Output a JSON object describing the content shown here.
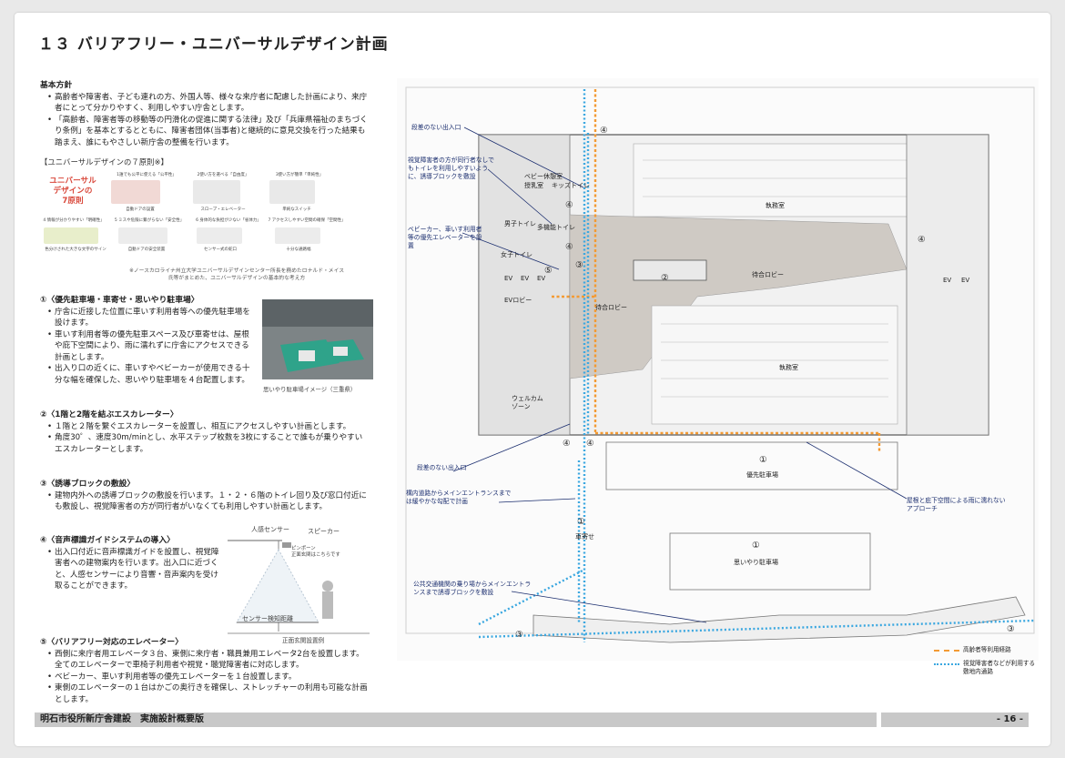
{
  "title": "１３ バリアフリー・ユニバーサルデザイン計画",
  "kihon": {
    "heading": "基本方針",
    "bullets": [
      "高齢者や障害者、子ども連れの方、外国人等、様々な来庁者に配慮した計画により、来庁者にとって分かりやすく、利用しやすい庁舎とします。",
      "「高齢者、障害者等の移動等の円滑化の促進に関する法律」及び「兵庫県福祉のまちづくり条例」を基本とするとともに、障害者団体(当事者)と継続的に意見交換を行った結果も踏まえ、誰にもやさしい新庁舎の整備を行います。"
    ]
  },
  "ud": {
    "heading": "【ユニバーサルデザインの７原則※】",
    "red_label": "ユニバーサル\nデザインの\n7原則",
    "cells": [
      "1誰でも公平に使える「公平性」",
      "2使い方を選べる「自由度」",
      "3使い方が簡単「単純性」",
      "自動ドアの設置",
      "スロープ・エレベーター",
      "単純なスイッチ",
      "4 情報が分かりやすい「明確性」",
      "5 ミスや危険に繋がらない「安全性」",
      "6 身体的な負担が少ない「省体力」",
      "7 アクセスしやすい空間の確保「空間性」",
      "色分けされた大きな文字のサイン",
      "自動ドアの安全装置",
      "センサー式の蛇口",
      "十分な通路幅"
    ],
    "note": "※ノースカロライナ州立大学ユニバーサルデザインセンター所長を務めたロナルド・メイス氏等がまとめた、ユニバーサルデザインの基本的な考え方"
  },
  "sec1": {
    "heading": "①〈優先駐車場・車寄せ・思いやり駐車場〉",
    "bullets": [
      "庁舎に近接した位置に車いす利用者等への優先駐車場を設けます。",
      "車いす利用者等の優先駐車スペース及び車寄せは、屋根や庇下空間により、雨に濡れずに庁舎にアクセスできる計画とします。",
      "出入り口の近くに、車いすやベビーカーが使用できる十分な幅を確保した、思いやり駐車場を４台配置します。"
    ],
    "caption": "思いやり駐車場イメージ（三重県）"
  },
  "sec2": {
    "heading": "②〈1階と2階を結ぶエスカレーター〉",
    "bullets": [
      "１階と２階を繋ぐエスカレーターを設置し、相互にアクセスしやすい計画とします。",
      "角度30゜、速度30m/minとし、水平ステップ枚数を3枚にすることで誰もが乗りやすいエスカレーターとします。"
    ]
  },
  "sec3": {
    "heading": "③〈誘導ブロックの敷設〉",
    "bullets": [
      "建物内外への誘導ブロックの敷設を行います。１・２・６階のトイレ回り及び窓口付近にも敷設し、視覚障害者の方が同行者がいなくても利用しやすい計画とします。"
    ]
  },
  "sec4": {
    "heading": "④〈音声標識ガイドシステムの導入〉",
    "bullets": [
      "出入口付近に音声標識ガイドを設置し、視覚障害者への建物案内を行います。出入口に近づくと、人感センサーにより音響・音声案内を受け取ることができます。"
    ],
    "fig": {
      "sensor": "人感センサー",
      "speaker": "スピーカー",
      "chime": "ピンポーン\n正面玄関はこちらです",
      "range": "センサー検知距離",
      "caption": "正面玄関設置例"
    }
  },
  "sec5": {
    "heading": "⑤〈バリアフリー対応のエレベーター〉",
    "bullets": [
      "西側に来庁者用エレベータ３台、東側に来庁者・職員兼用エレベータ2台を設置します。全てのエレベーターで車椅子利用者や視覚・聴覚障害者に対応します。",
      "ベビーカー、車いす利用者等の優先エレベーターを１台設置します。",
      "東側のエレベーターの１台はかごの奥行きを確保し、ストレッチャーの利用も可能な計画とします。"
    ]
  },
  "plan": {
    "callouts": [
      "段差のない出入口",
      "視覚障害者の方が同行者なしでもトイレを利用しやすいように、誘導ブロックを敷設",
      "ベビーカー、車いす利用者等の優先エレベーターを設置",
      "段差のない出入口",
      "構内道路からメインエントランスまでは緩やかな勾配で計画",
      "公共交通機関の乗り場からメインエントランスまで誘導ブロックを敷設",
      "屋根と庇下空間による雨に濡れないアプローチ"
    ],
    "rooms": [
      "ベビー休憩室",
      "授乳室",
      "キッズトイレ",
      "男子トイレ",
      "女子トイレ",
      "多機能トイレ",
      "EV",
      "EV",
      "EV",
      "EVロビー",
      "待合ロビー",
      "待合ロビー",
      "執務室",
      "執務室",
      "ウェルカムゾーン",
      "優先駐車場",
      "思いやり駐車場",
      "車寄せ",
      "EV",
      "EV"
    ],
    "numbers": [
      "④",
      "④",
      "④",
      "④",
      "④",
      "④",
      "③",
      "③",
      "③",
      "⑤",
      "②",
      "①",
      "①",
      "①"
    ]
  },
  "legend": {
    "orange": "高齢者等利用経路",
    "blue": "視覚障害者などが利用する敷地内通路"
  },
  "footer": {
    "title": "明石市役所新庁舎建設　実施設計概要版",
    "page": "- 16 -"
  }
}
